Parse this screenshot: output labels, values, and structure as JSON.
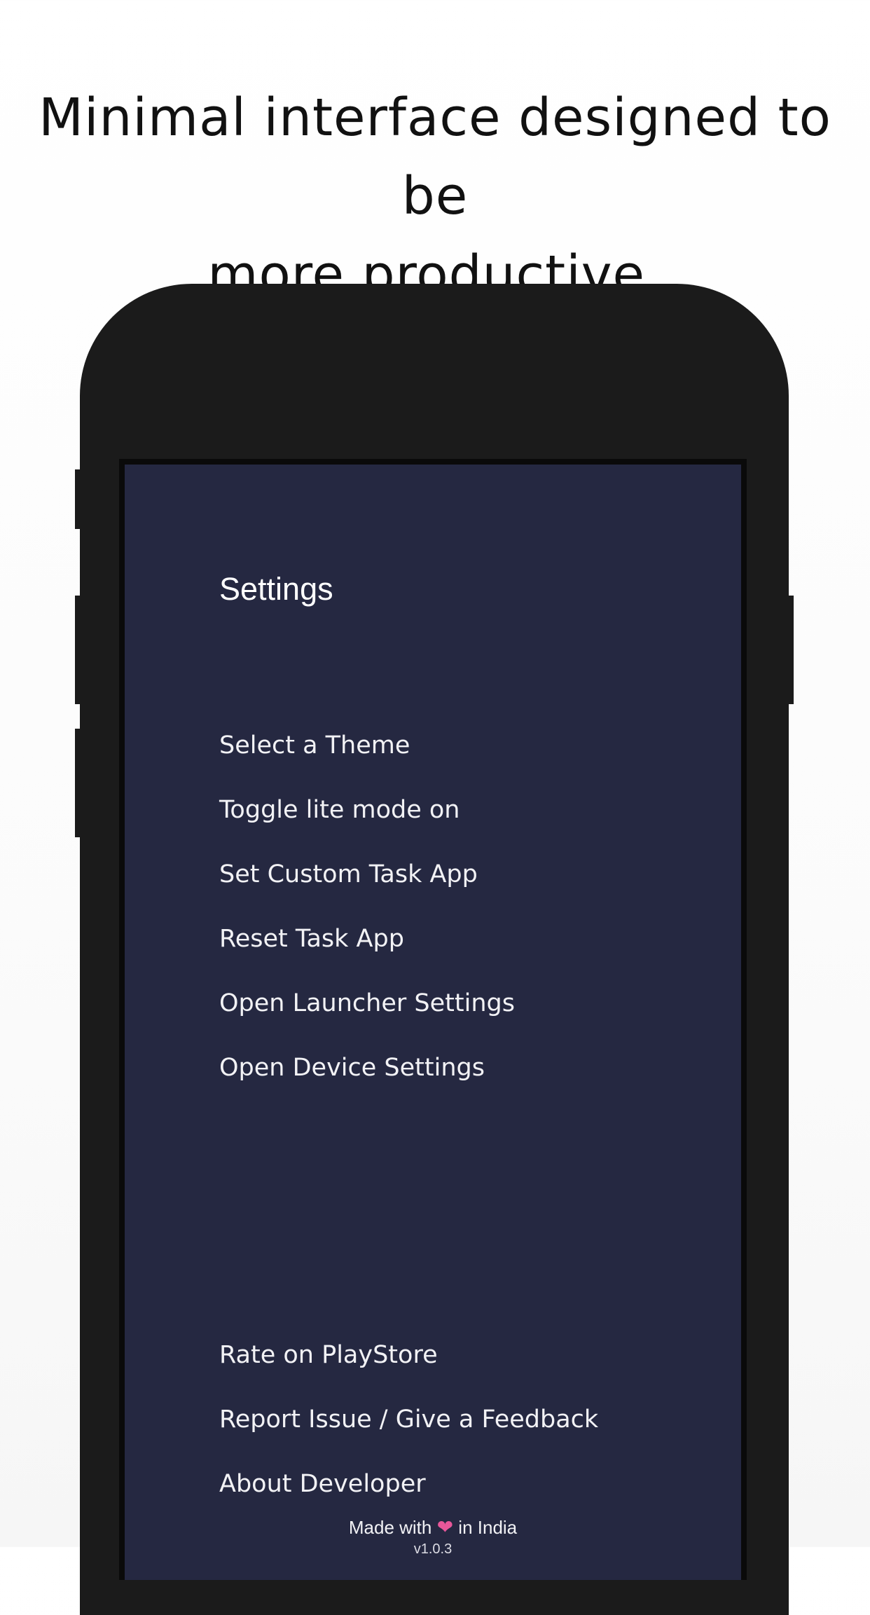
{
  "headline": {
    "line1": "Minimal interface designed to be",
    "line2": "more productive."
  },
  "settings": {
    "title": "Settings",
    "top_items": [
      "Select a Theme",
      "Toggle lite mode on",
      "Set Custom Task App",
      "Reset Task App",
      "Open Launcher Settings",
      "Open Device Settings"
    ],
    "bottom_items": [
      "Rate on PlayStore",
      "Report Issue / Give a Feedback",
      "About Developer"
    ]
  },
  "footer": {
    "made_with": "Made with",
    "heart_icon": "heart-icon",
    "heart_color": "#e8579a",
    "in_india": "in India",
    "version": "v1.0.3"
  },
  "colors": {
    "screen_background": "#252841",
    "phone_body": "#1b1b1b"
  }
}
